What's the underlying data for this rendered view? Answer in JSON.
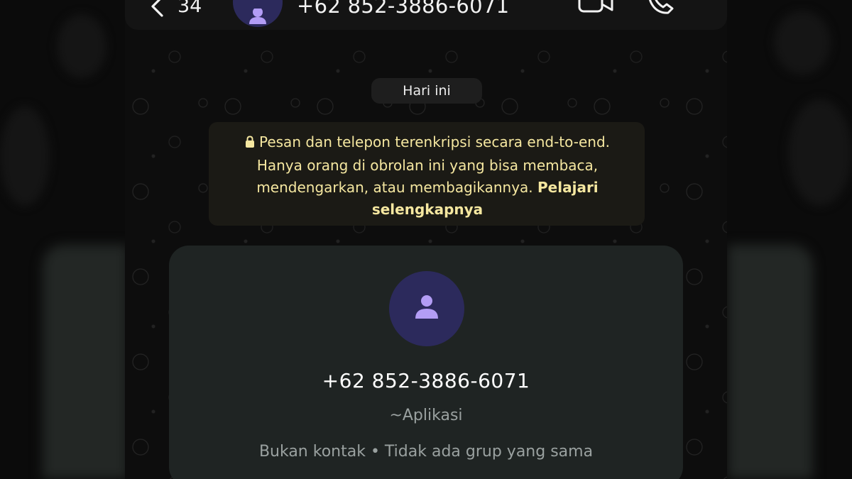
{
  "header": {
    "back_count": "34",
    "contact_title": "+62 852-3886-6071"
  },
  "chat": {
    "date_label": "Hari ini",
    "encryption_notice": "Pesan dan telepon terenkripsi secara end-to-end. Hanya orang di obrolan ini yang bisa membaca, mendengarkan, atau membagikannya.",
    "encryption_link": "Pelajari selengkapnya"
  },
  "contact_card": {
    "phone": "+62 852-3886-6071",
    "display_name": "~Aplikasi",
    "info": "Bukan kontak • Tidak ada grup yang sama"
  },
  "colors": {
    "accent_avatar_bg": "#2c2a5c",
    "accent_avatar_icon": "#b39df5",
    "notice_text": "#f5e7a0",
    "card_bg": "#1f2423"
  },
  "icons": [
    "chevron-left-icon",
    "person-icon",
    "video-camera-icon",
    "phone-icon",
    "lock-icon"
  ]
}
